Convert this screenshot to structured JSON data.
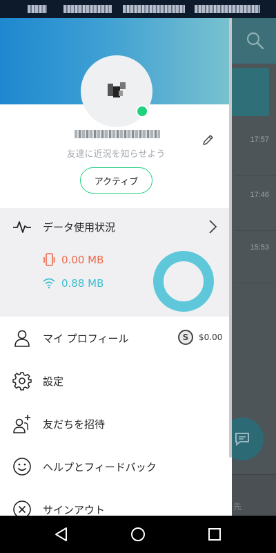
{
  "background": {
    "times": [
      "17:57",
      "17:46",
      "15:53"
    ],
    "bottom_label": "先"
  },
  "drawer": {
    "tagline": "友達に近況を知らせよう",
    "status_button": "アクティブ",
    "usage": {
      "title": "データ使用状況",
      "mobile": "0.00 MB",
      "wifi": "0.88 MB"
    },
    "menu": [
      {
        "label": "マイ プロフィール",
        "icon": "person-icon"
      },
      {
        "label": "設定",
        "icon": "gear-icon"
      },
      {
        "label": "友だちを招待",
        "icon": "add-person-icon"
      },
      {
        "label": "ヘルプとフィードバック",
        "icon": "smiley-icon"
      },
      {
        "label": "サインアウト",
        "icon": "close-circle-icon"
      }
    ],
    "balance": {
      "coin_symbol": "S",
      "amount": "$0.00"
    }
  },
  "colors": {
    "accent": "#22d17f",
    "mobile": "#ef6a4c",
    "wifi": "#3bbfd0",
    "header_gradient_start": "#1e88d0",
    "header_gradient_end": "#79c2cf"
  }
}
